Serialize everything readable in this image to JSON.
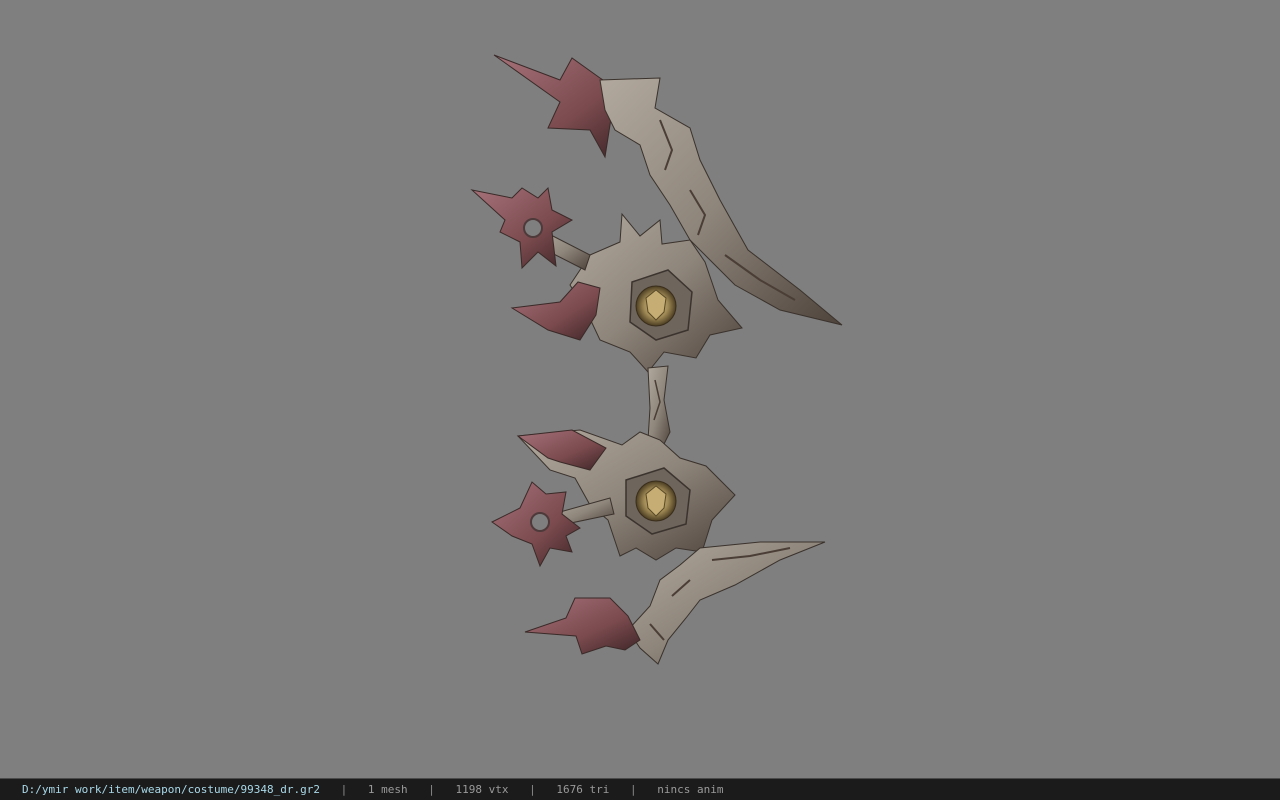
{
  "status_bar": {
    "file_path": "D:/ymir work/item/weapon/costume/99348_dr.gr2",
    "separator": "|",
    "mesh_count": "1 mesh",
    "vertex_count": "1198 vtx",
    "triangle_count": "1676 tri",
    "animation": "nincs anim"
  },
  "viewport": {
    "background_color": "#7f7f7f",
    "model_subject": "spiked-bow-weapon-model"
  },
  "colors": {
    "stone": "#8e857b",
    "stone_dark": "#4e433b",
    "crimson": "#7a4a4e",
    "gold": "#a08a55",
    "path_text": "#a8d8e8"
  }
}
